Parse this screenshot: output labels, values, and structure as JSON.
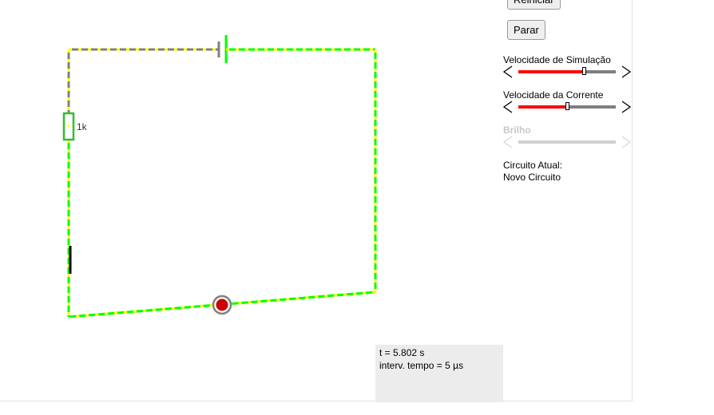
{
  "buttons": {
    "reset_label": "Reiniciar",
    "stop_label": "Parar"
  },
  "sliders": [
    {
      "label": "Velocidade de Simulação",
      "value": 0.67,
      "enabled": true
    },
    {
      "label": "Velocidade da Corrente",
      "value": 0.5,
      "enabled": true
    },
    {
      "label": "Brilho",
      "value": 0,
      "enabled": false
    }
  ],
  "current_circuit": {
    "label": "Circuito Atual:",
    "name": "Novo Circuito"
  },
  "circuit": {
    "resistor_label": "1k"
  },
  "status": {
    "time": "t = 5.802 s",
    "timestep": "interv. tempo = 5 µs"
  },
  "colors": {
    "wire_current": "#00ff00",
    "current_dots": "#ffff00",
    "wire_idle": "#808080",
    "slider_fill": "#ff0000",
    "slider_track": "#7f7f7f",
    "probe": "#cc0000"
  }
}
